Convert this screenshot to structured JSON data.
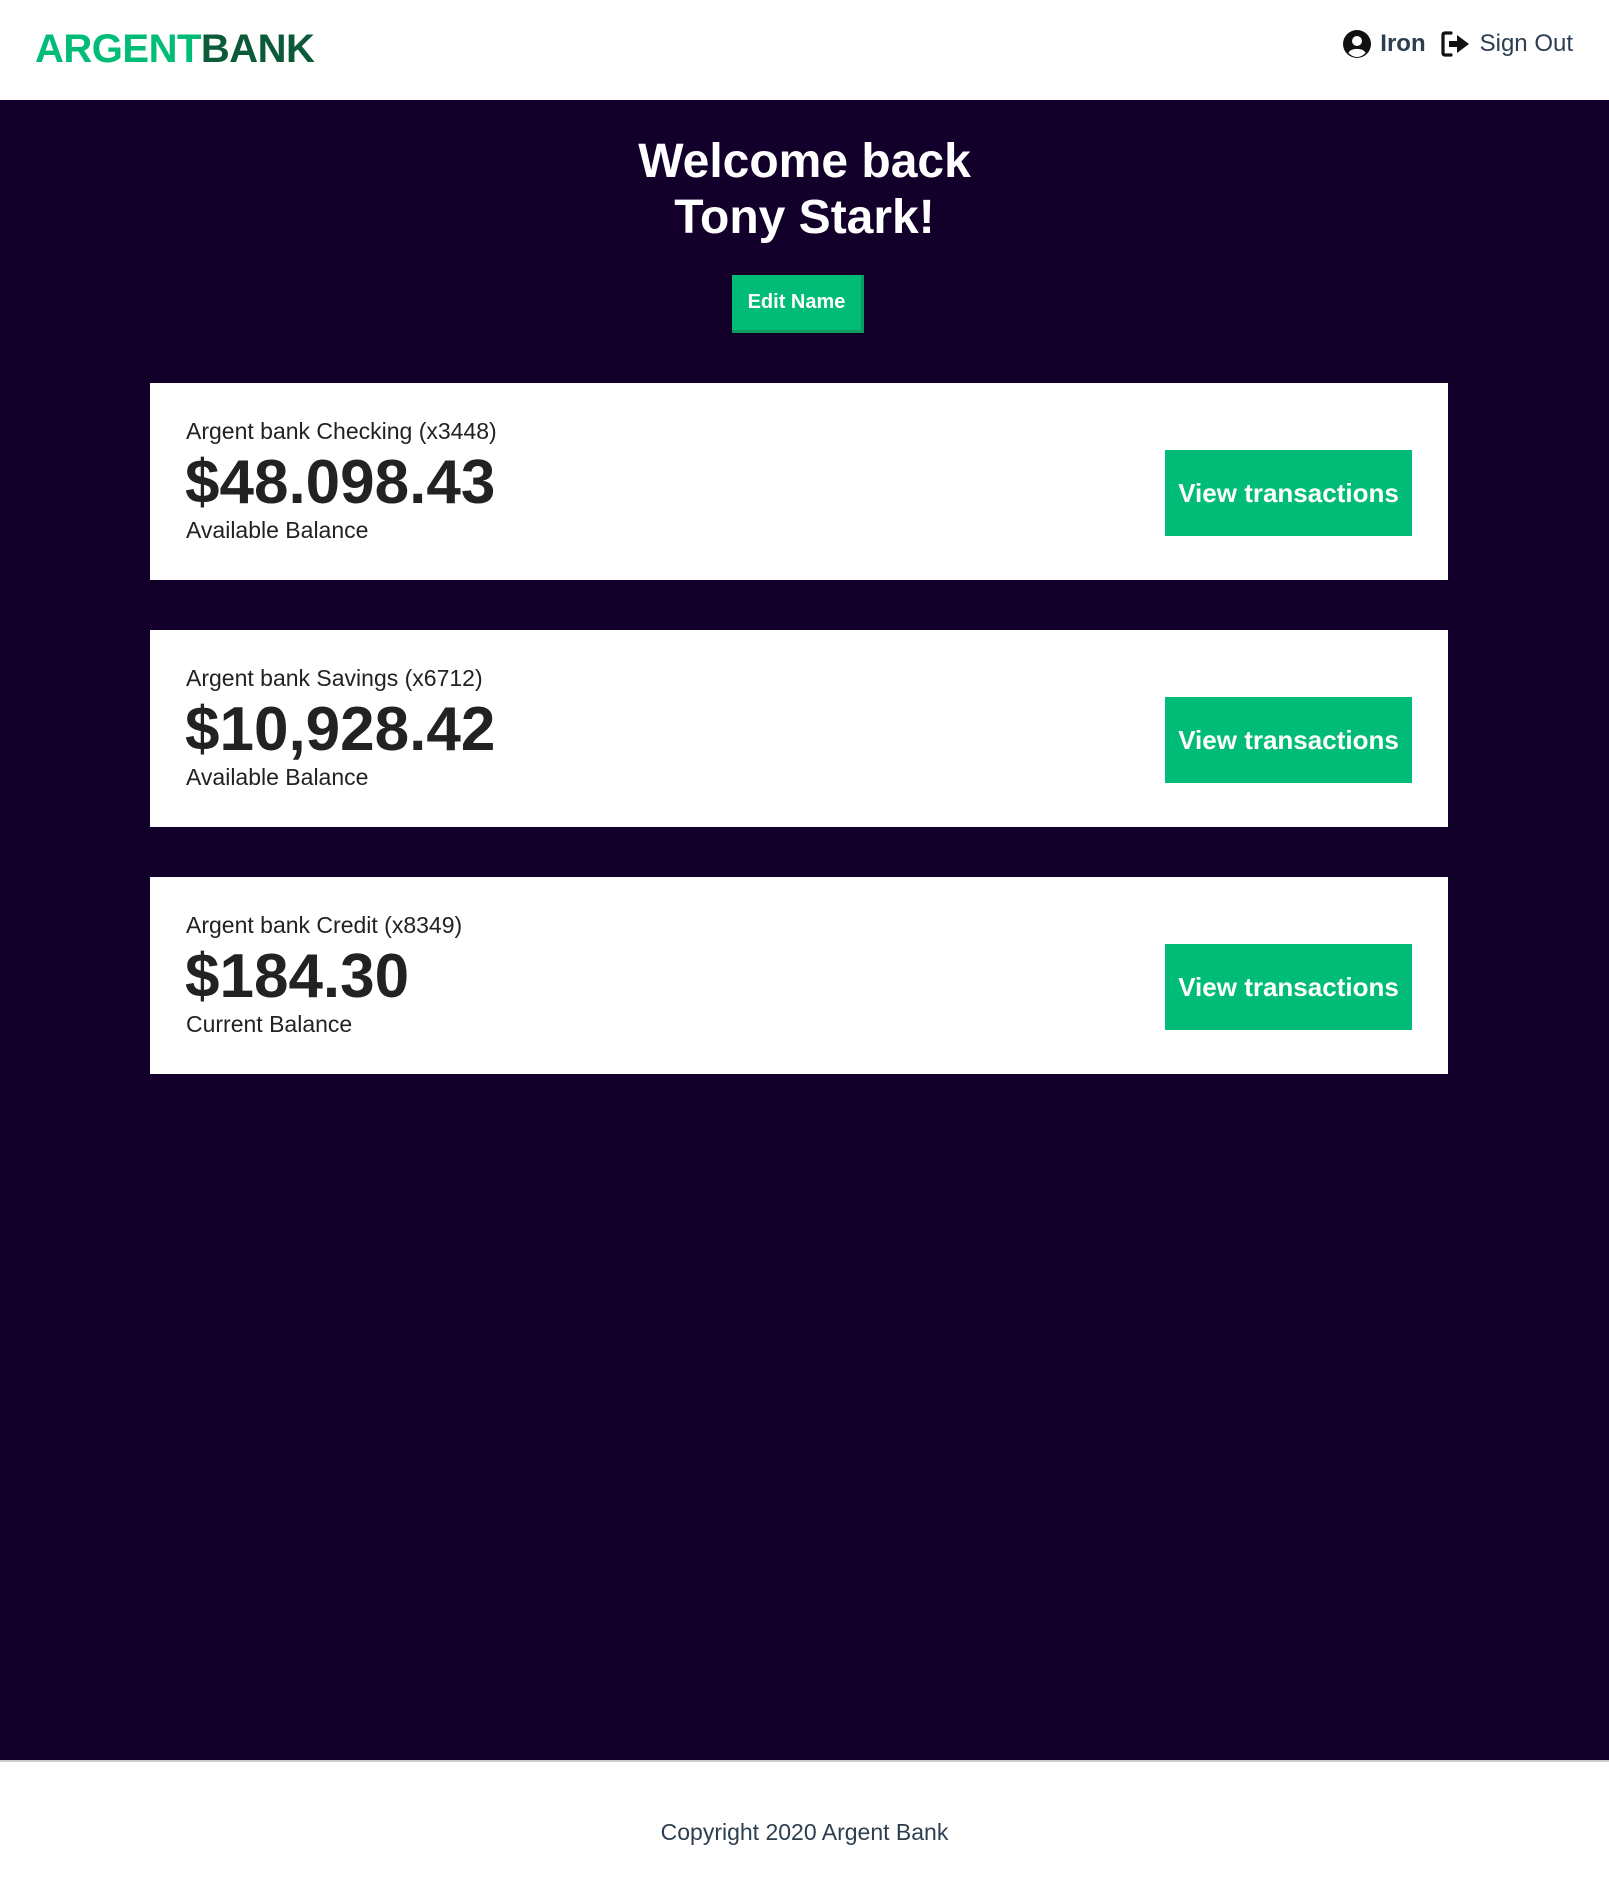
{
  "header": {
    "logo_part1": "ARGENT",
    "logo_part2": "BANK",
    "user_name": "Iron",
    "user_icon": "user-circle-icon",
    "signout_label": "Sign Out",
    "signout_icon": "sign-out-icon"
  },
  "welcome": {
    "line1": "Welcome back",
    "line2": "Tony Stark!",
    "edit_label": "Edit Name"
  },
  "accounts": [
    {
      "title": "Argent bank Checking (x3448)",
      "amount": "$48.098.43",
      "description": "Available Balance",
      "button": "View transactions"
    },
    {
      "title": "Argent bank Savings (x6712)",
      "amount": "$10,928.42",
      "description": "Available Balance",
      "button": "View transactions"
    },
    {
      "title": "Argent bank Credit (x8349)",
      "amount": "$184.30",
      "description": "Current Balance",
      "button": "View transactions"
    }
  ],
  "footer": {
    "copyright": "Copyright 2020 Argent Bank"
  },
  "colors": {
    "brand_green": "#00bc77",
    "brand_dark_green": "#0b5a38",
    "background_dark": "#12002b",
    "text_dark": "#2c3e50"
  }
}
